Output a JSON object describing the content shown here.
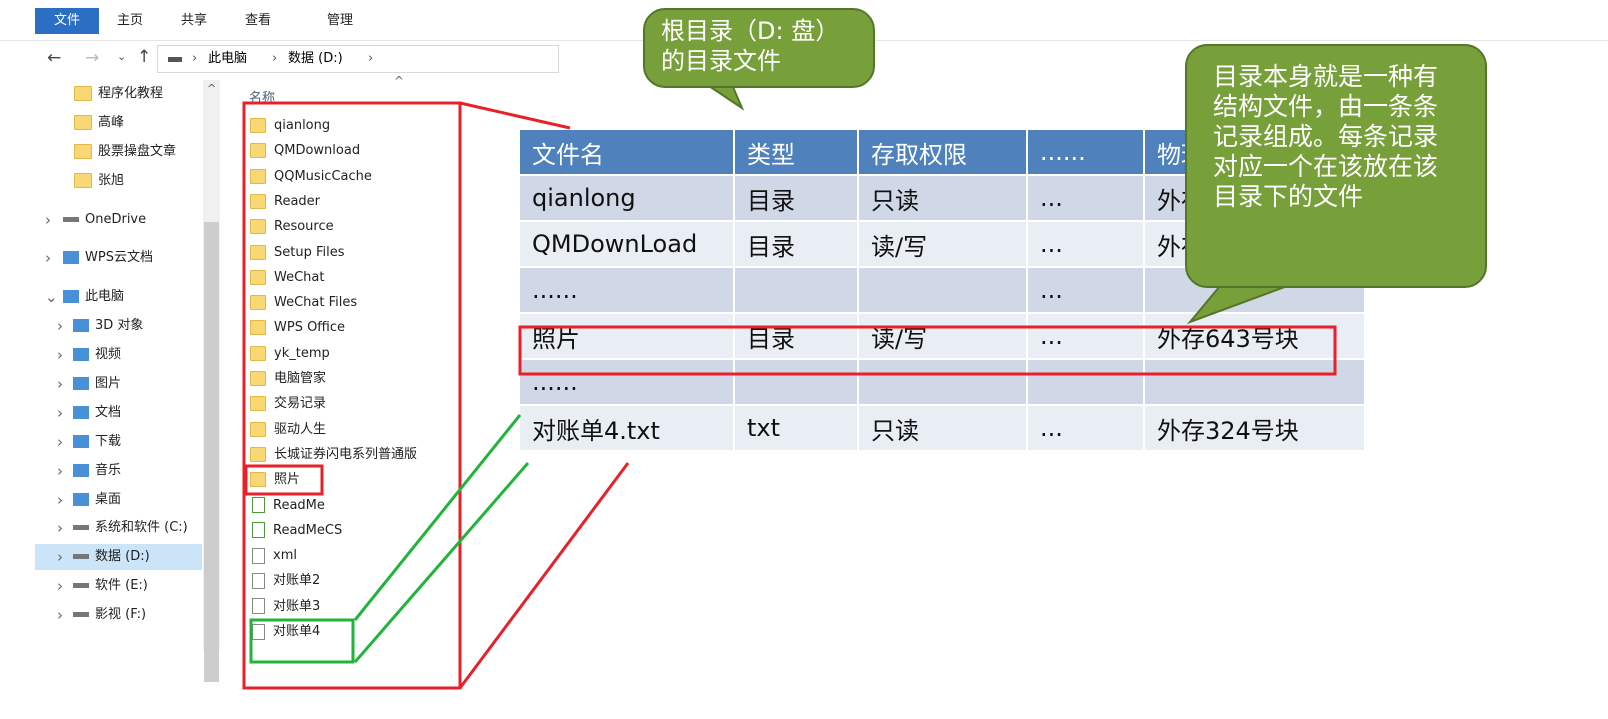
{
  "ribbon": {
    "tabs": [
      "文件",
      "主页",
      "共享",
      "查看",
      "管理"
    ],
    "active_color": "#2b6fc4"
  },
  "address": {
    "crumbs": [
      "此电脑",
      "数据 (D:)"
    ]
  },
  "column_header": "名称",
  "nav": {
    "quick": [
      "程序化教程",
      "高峰",
      "股票操盘文章",
      "张旭"
    ],
    "items": [
      {
        "label": "OneDrive",
        "icon": "onedrive-cloud-icon"
      },
      {
        "label": "WPS云文档",
        "icon": "wps-cloud-icon"
      },
      {
        "label": "此电脑",
        "icon": "computer-icon",
        "expanded": true
      },
      {
        "label": "3D 对象",
        "icon": "3d-objects-icon"
      },
      {
        "label": "视频",
        "icon": "video-icon"
      },
      {
        "label": "图片",
        "icon": "pictures-icon"
      },
      {
        "label": "文档",
        "icon": "documents-icon"
      },
      {
        "label": "下载",
        "icon": "download-icon"
      },
      {
        "label": "音乐",
        "icon": "music-icon"
      },
      {
        "label": "桌面",
        "icon": "desktop-icon"
      },
      {
        "label": "系统和软件 (C:)",
        "icon": "drive-icon"
      },
      {
        "label": "数据 (D:)",
        "icon": "drive-icon",
        "selected": true
      },
      {
        "label": "软件 (E:)",
        "icon": "drive-icon"
      },
      {
        "label": "影视 (F:)",
        "icon": "drive-icon"
      }
    ]
  },
  "files": [
    {
      "name": "qianlong",
      "type": "folder"
    },
    {
      "name": "QMDownload",
      "type": "folder"
    },
    {
      "name": "QQMusicCache",
      "type": "folder"
    },
    {
      "name": "Reader",
      "type": "folder"
    },
    {
      "name": "Resource",
      "type": "folder"
    },
    {
      "name": "Setup Files",
      "type": "folder"
    },
    {
      "name": "WeChat",
      "type": "folder"
    },
    {
      "name": "WeChat Files",
      "type": "folder"
    },
    {
      "name": "WPS Office",
      "type": "folder"
    },
    {
      "name": "yk_temp",
      "type": "folder"
    },
    {
      "name": "电脑管家",
      "type": "folder"
    },
    {
      "name": "交易记录",
      "type": "folder"
    },
    {
      "name": "驱动人生",
      "type": "folder"
    },
    {
      "name": "长城证券闪电系列普通版",
      "type": "folder"
    },
    {
      "name": "照片",
      "type": "folder"
    },
    {
      "name": "ReadMe",
      "type": "app"
    },
    {
      "name": "ReadMeCS",
      "type": "app"
    },
    {
      "name": "xml",
      "type": "file"
    },
    {
      "name": "对账单2",
      "type": "file"
    },
    {
      "name": "对账单3",
      "type": "file"
    },
    {
      "name": "对账单4",
      "type": "file"
    }
  ],
  "table": {
    "headers": [
      "文件名",
      "类型",
      "存取权限",
      "......",
      "物理"
    ],
    "rows": [
      [
        "qianlong",
        "目录",
        "只读",
        "...",
        "外存"
      ],
      [
        "QMDownLoad",
        "目录",
        "读/写",
        "...",
        "外存"
      ],
      [
        "......",
        "",
        "",
        "...",
        ""
      ],
      [
        "照片",
        "目录",
        "读/写",
        "...",
        "外存643号块"
      ],
      [
        "......",
        "",
        "",
        "",
        ""
      ],
      [
        "对账单4.txt",
        "txt",
        "只读",
        "...",
        "外存324号块"
      ]
    ]
  },
  "callouts": {
    "root": "根目录（D: 盘）的目录文件",
    "structure": "目录本身就是一种有结构文件，由一条条记录组成。每条记录对应一个在该放在该目录下的文件"
  },
  "colors": {
    "highlight_red": "#e8202a",
    "highlight_green": "#22b33a",
    "callout_green": "#77a03b",
    "table_header": "#4f81bd"
  }
}
